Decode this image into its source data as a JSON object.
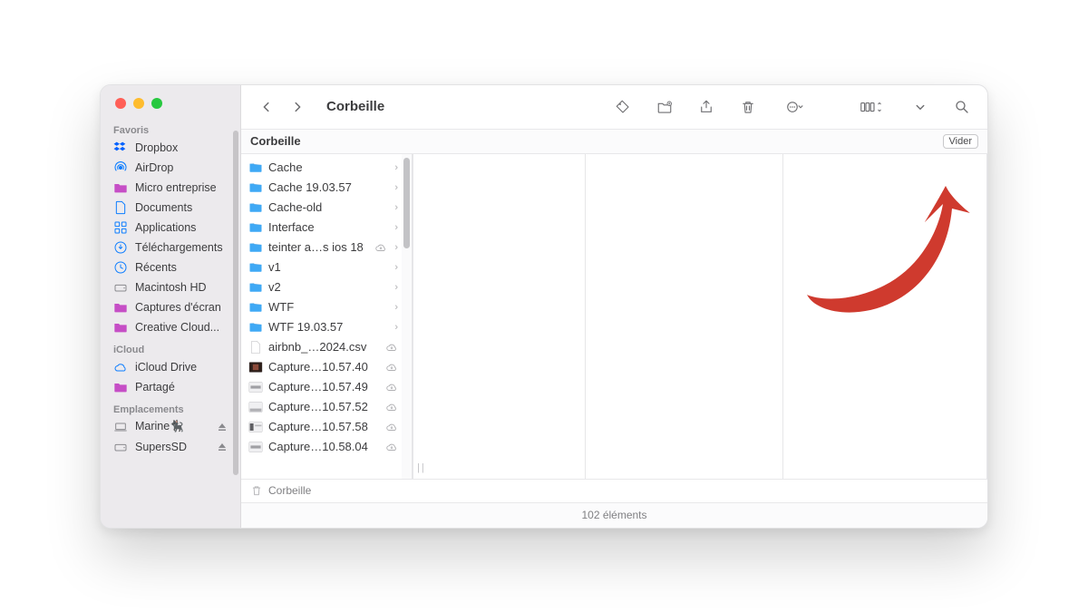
{
  "window": {
    "title": "Corbeille",
    "section_title": "Corbeille",
    "empty_button": "Vider",
    "pathbar": "Corbeille",
    "status": "102 éléments"
  },
  "sidebar": {
    "sections": [
      {
        "title": "Favoris",
        "items": [
          {
            "label": "Dropbox",
            "icon": "dropbox",
            "color": "blue"
          },
          {
            "label": "AirDrop",
            "icon": "airdrop",
            "color": "blue"
          },
          {
            "label": "Micro entreprise",
            "icon": "folder",
            "color": "pink"
          },
          {
            "label": "Documents",
            "icon": "doc",
            "color": "blue"
          },
          {
            "label": "Applications",
            "icon": "apps",
            "color": "blue"
          },
          {
            "label": "Téléchargements",
            "icon": "download",
            "color": "blue"
          },
          {
            "label": "Récents",
            "icon": "clock",
            "color": "blue"
          },
          {
            "label": "Macintosh HD",
            "icon": "disk",
            "color": "grey"
          },
          {
            "label": "Captures d'écran",
            "icon": "folder",
            "color": "pink"
          },
          {
            "label": "Creative Cloud...",
            "icon": "folder",
            "color": "pink"
          }
        ]
      },
      {
        "title": "iCloud",
        "items": [
          {
            "label": "iCloud Drive",
            "icon": "cloud",
            "color": "blue"
          },
          {
            "label": "Partagé",
            "icon": "folder",
            "color": "pink"
          }
        ]
      },
      {
        "title": "Emplacements",
        "items": [
          {
            "label": "Marine🐈‍⬛",
            "icon": "laptop",
            "color": "grey",
            "eject": true
          },
          {
            "label": "SupersSD",
            "icon": "disk",
            "color": "grey",
            "eject": true
          }
        ]
      }
    ]
  },
  "files": [
    {
      "name": "Cache",
      "type": "folder",
      "chevron": true
    },
    {
      "name": "Cache 19.03.57",
      "type": "folder",
      "chevron": true
    },
    {
      "name": "Cache-old",
      "type": "folder",
      "chevron": true
    },
    {
      "name": "Interface",
      "type": "folder",
      "chevron": true
    },
    {
      "name": "teinter a…s ios 18",
      "type": "folder",
      "cloud": true,
      "chevron": true
    },
    {
      "name": "v1",
      "type": "folder",
      "chevron": true
    },
    {
      "name": "v2",
      "type": "folder",
      "chevron": true
    },
    {
      "name": "WTF",
      "type": "folder",
      "chevron": true
    },
    {
      "name": "WTF 19.03.57",
      "type": "folder",
      "chevron": true
    },
    {
      "name": "airbnb_…2024.csv",
      "type": "file-blank",
      "cloud": true
    },
    {
      "name": "Capture…10.57.40",
      "type": "file-img-a",
      "cloud": true
    },
    {
      "name": "Capture…10.57.49",
      "type": "file-img-b",
      "cloud": true
    },
    {
      "name": "Capture…10.57.52",
      "type": "file-img-c",
      "cloud": true
    },
    {
      "name": "Capture…10.57.58",
      "type": "file-img-d",
      "cloud": true
    },
    {
      "name": "Capture…10.58.04",
      "type": "file-img-b",
      "cloud": true
    }
  ]
}
